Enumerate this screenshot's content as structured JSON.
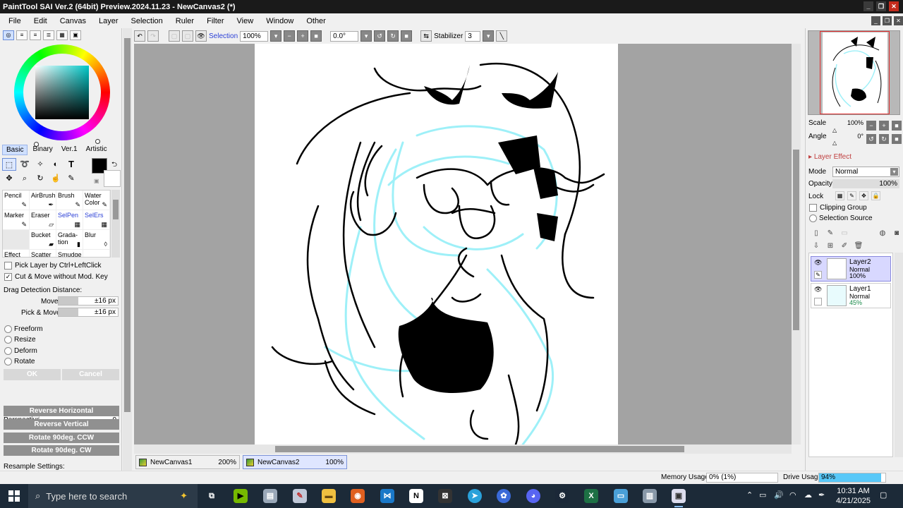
{
  "window": {
    "title": "PaintTool SAI Ver.2 (64bit) Preview.2024.11.23 - NewCanvas2 (*)"
  },
  "menu": [
    "File",
    "Edit",
    "Canvas",
    "Layer",
    "Selection",
    "Ruler",
    "Filter",
    "View",
    "Window",
    "Other"
  ],
  "color_panel": {
    "tabs": [
      "Basic",
      "Binary",
      "Ver.1",
      "Artistic"
    ],
    "active_tab": "Basic",
    "fg_color": "#000000",
    "bg_color": "#ffffff",
    "hue_color": "#00c8c8"
  },
  "tools": [
    {
      "icon": "rect-select-icon",
      "glyph": "⬚"
    },
    {
      "icon": "lasso-icon",
      "glyph": "➰"
    },
    {
      "icon": "magic-wand-icon",
      "glyph": "✧"
    },
    {
      "icon": "shape-icon",
      "glyph": "◐"
    },
    {
      "icon": "text-icon",
      "glyph": "T"
    },
    {
      "icon": "move-icon",
      "glyph": "✥"
    },
    {
      "icon": "zoom-icon",
      "glyph": "🔍"
    },
    {
      "icon": "rotate-icon",
      "glyph": "↻"
    },
    {
      "icon": "hand-icon",
      "glyph": "✋"
    },
    {
      "icon": "eyedropper-icon",
      "glyph": "✎"
    }
  ],
  "brushes": [
    {
      "label": "Pencil",
      "icon": "✎"
    },
    {
      "label": "AirBrush",
      "icon": "✒"
    },
    {
      "label": "Brush",
      "icon": "✎"
    },
    {
      "label": "Water Color",
      "icon": "✎"
    },
    {
      "label": "Marker",
      "icon": "✎"
    },
    {
      "label": "Eraser",
      "icon": "▱"
    },
    {
      "label": "SelPen",
      "icon": "▦"
    },
    {
      "label": "SelErs",
      "icon": "▦"
    },
    {
      "label": "",
      "icon": ""
    },
    {
      "label": "Bucket",
      "icon": "▰"
    },
    {
      "label": "Grada-tion",
      "icon": "▮"
    },
    {
      "label": "Blur",
      "icon": "💧"
    },
    {
      "label": "Effect",
      "icon": ""
    },
    {
      "label": "Scatter",
      "icon": ""
    },
    {
      "label": "Smudge",
      "icon": ""
    },
    {
      "label": "",
      "icon": ""
    }
  ],
  "options": {
    "pick_layer": "Pick Layer by Ctrl+LeftClick",
    "pick_layer_checked": "",
    "cut_move": "Cut & Move without Mod. Key",
    "cut_move_checked": "✓",
    "drag_detection": "Drag Detection Distance:",
    "move_label": "Move",
    "move_value": "±16 px",
    "pickmove_label": "Pick & Move",
    "pickmove_value": "±16 px",
    "transform_modes": [
      "Freeform",
      "Resize",
      "Deform",
      "Rotate"
    ],
    "ok": "OK",
    "cancel": "Cancel",
    "perspective_label": "Perspective",
    "perspective_value": "0",
    "buttons": [
      "Reverse Horizontal",
      "Reverse Vertical",
      "Rotate 90deg. CCW",
      "Rotate 90deg. CW"
    ],
    "resample": "Resample Settings:"
  },
  "canvas_toolbar": {
    "selection_label": "Selection",
    "zoom": "100%",
    "angle": "0.0°",
    "stabilizer_label": "Stabilizer",
    "stabilizer_value": "3"
  },
  "doc_tabs": [
    {
      "name": "NewCanvas1",
      "zoom": "200%"
    },
    {
      "name": "NewCanvas2",
      "zoom": "100%"
    }
  ],
  "navigator": {
    "scale_label": "Scale",
    "scale_value": "100%",
    "angle_label": "Angle",
    "angle_value": "0°"
  },
  "layer_panel": {
    "layer_effect": "Layer Effect",
    "mode_label": "Mode",
    "mode_value": "Normal",
    "opacity_label": "Opacity",
    "opacity_value": "100%",
    "lock_label": "Lock",
    "clipping_group": "Clipping Group",
    "selection_source": "Selection Source",
    "layers": [
      {
        "name": "Layer2",
        "mode": "Normal",
        "opacity": "100%"
      },
      {
        "name": "Layer1",
        "mode": "Normal",
        "opacity": "45%"
      }
    ]
  },
  "status": {
    "memory_label": "Memory Usage",
    "memory_value": "0% (1%)",
    "drive_label": "Drive Usage",
    "drive_value": "94%",
    "drive_fraction": 0.94
  },
  "taskbar": {
    "search_placeholder": "Type here to search",
    "time": "10:31 AM",
    "date": "4/21/2025"
  }
}
